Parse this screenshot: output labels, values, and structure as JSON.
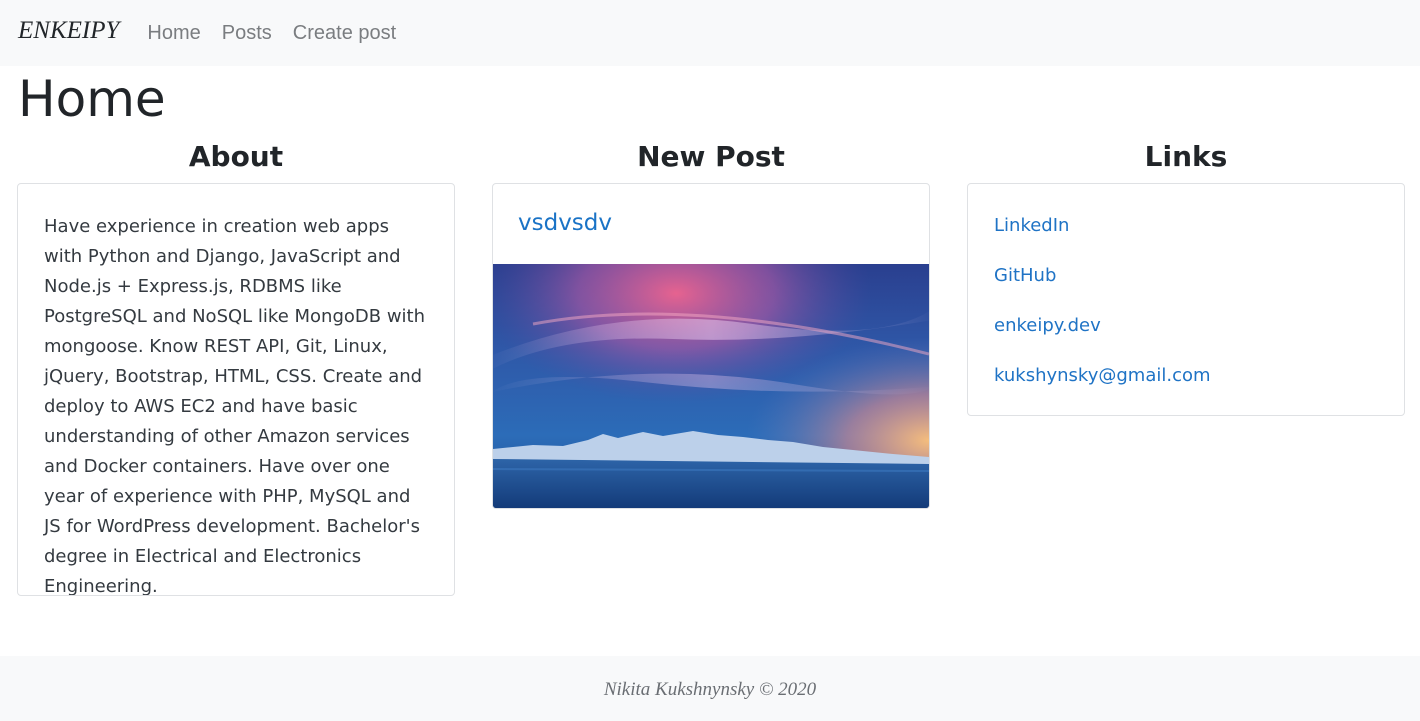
{
  "navbar": {
    "brand": "ENKEIPY",
    "links": [
      "Home",
      "Posts",
      "Create post"
    ]
  },
  "page_title": "Home",
  "about": {
    "title": "About",
    "text": "Have experience in creation web apps with Python and Django, JavaScript and Node.js + Express.js, RDBMS like PostgreSQL and NoSQL like MongoDB with mongoose. Know REST API, Git, Linux, jQuery, Bootstrap, HTML, CSS. Create and deploy to AWS EC2 and have basic understanding of other Amazon services and Docker containers. Have over one year of experience with PHP, MySQL and JS for WordPress development. Bachelor's degree in Electrical and Electronics Engineering."
  },
  "new_post": {
    "title": "New Post",
    "post_title": "vsdvsdv",
    "image": "sunset-mountains-sky-image"
  },
  "links": {
    "title": "Links",
    "items": [
      "LinkedIn",
      "GitHub",
      "enkeipy.dev",
      "kukshynsky@gmail.com"
    ]
  },
  "footer": {
    "text": "Nikita Kukshnynsky © 2020"
  },
  "colors": {
    "navbar_bg": "#f8f9fa",
    "link": "#1f73c5",
    "nav_link": "#7a7d80",
    "text": "#212529"
  }
}
